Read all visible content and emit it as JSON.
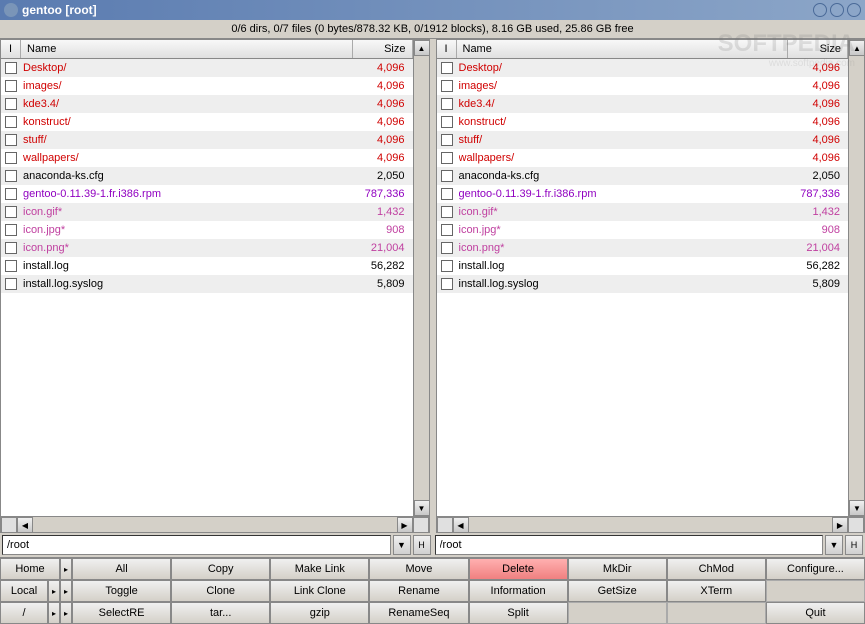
{
  "titlebar": {
    "title": "gentoo [root]"
  },
  "status": "0/6 dirs, 0/7 files (0 bytes/878.32 KB, 0/1912 blocks), 8.16 GB used, 25.86 GB free",
  "watermark": {
    "main": "SOFTPEDIA",
    "sub": "www.softpedia.com"
  },
  "columns": {
    "check": "I",
    "name": "Name",
    "size": "Size"
  },
  "path": {
    "left": "/root",
    "right": "/root",
    "history_btn": "H"
  },
  "files": [
    {
      "name": "Desktop/",
      "size": "4,096",
      "cls": "color-dir"
    },
    {
      "name": "images/",
      "size": "4,096",
      "cls": "color-dir"
    },
    {
      "name": "kde3.4/",
      "size": "4,096",
      "cls": "color-dir"
    },
    {
      "name": "konstruct/",
      "size": "4,096",
      "cls": "color-dir"
    },
    {
      "name": "stuff/",
      "size": "4,096",
      "cls": "color-dir"
    },
    {
      "name": "wallpapers/",
      "size": "4,096",
      "cls": "color-dir"
    },
    {
      "name": "anaconda-ks.cfg",
      "size": "2,050",
      "cls": "color-normal"
    },
    {
      "name": "gentoo-0.11.39-1.fr.i386.rpm",
      "size": "787,336",
      "cls": "color-rpm"
    },
    {
      "name": "icon.gif*",
      "size": "1,432",
      "cls": "color-img"
    },
    {
      "name": "icon.jpg*",
      "size": "908",
      "cls": "color-img"
    },
    {
      "name": "icon.png*",
      "size": "21,004",
      "cls": "color-img"
    },
    {
      "name": "install.log",
      "size": "56,282",
      "cls": "color-normal"
    },
    {
      "name": "install.log.syslog",
      "size": "5,809",
      "cls": "color-normal"
    }
  ],
  "leftbtns": {
    "home": "Home",
    "local": "Local",
    "slash": "/"
  },
  "grid": [
    [
      "All",
      "Copy",
      "Make Link",
      "Move",
      "Delete",
      "MkDir",
      "ChMod",
      "Configure..."
    ],
    [
      "Toggle",
      "Clone",
      "Link Clone",
      "Rename",
      "Information",
      "GetSize",
      "XTerm",
      ""
    ],
    [
      "SelectRE",
      "tar...",
      "gzip",
      "RenameSeq",
      "Split",
      "",
      "",
      "Quit"
    ]
  ]
}
